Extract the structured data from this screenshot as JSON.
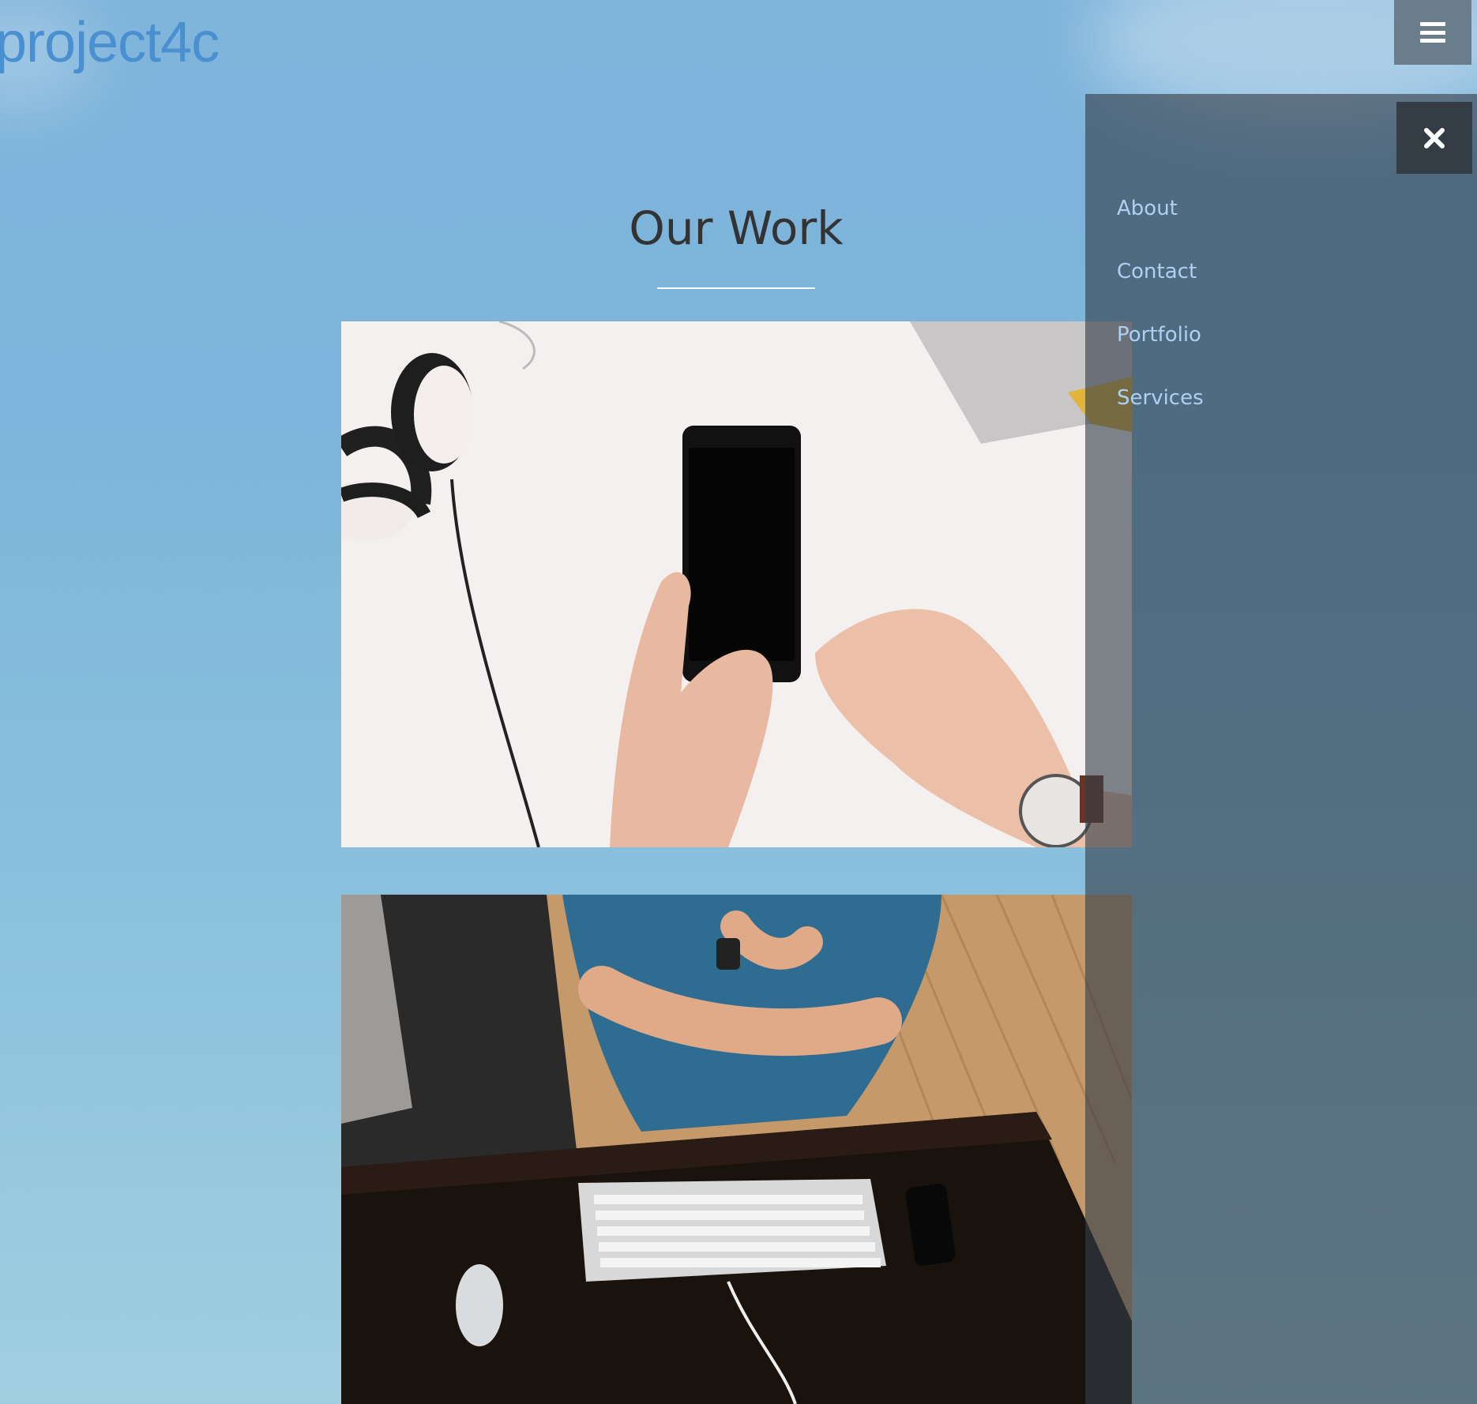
{
  "header": {
    "logo_text": "project4c",
    "menu_icon": "hamburger-icon"
  },
  "main": {
    "section_title": "Our Work",
    "portfolio": [
      {
        "subject": "hands holding smartphone with headphones on white desk"
      },
      {
        "subject": "man standing at wooden desk with keyboard, mouse and phone"
      }
    ]
  },
  "side_menu": {
    "close_icon": "close-icon",
    "items": [
      {
        "label": "About"
      },
      {
        "label": "Contact"
      },
      {
        "label": "Portfolio"
      },
      {
        "label": "Services"
      }
    ]
  },
  "colors": {
    "logo": "#4a8fcf",
    "nav_link": "#aed0f2",
    "title": "#333333",
    "menu_button": "#6a7d8b",
    "close_button": "#343d45"
  }
}
